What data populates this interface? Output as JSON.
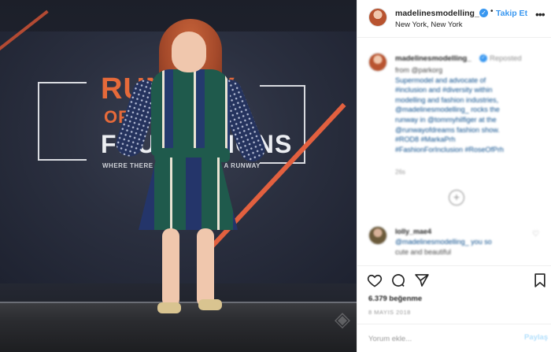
{
  "photo": {
    "sign": {
      "line1": "RUNWAY",
      "line2": "OF",
      "line3": "FOUNDATIONS",
      "line4": "WHERE THERE IS A WILL THERE IS A RUNWAY"
    }
  },
  "header": {
    "username": "madelinesmodelling_",
    "verified_glyph": "✓",
    "follow_label": "Takip Et",
    "location": "New York, New York",
    "more_glyph": "•••"
  },
  "caption": {
    "username": "madelinesmodelling_",
    "reposted": "Reposted",
    "lines": [
      "from @parkorg",
      "Supermodel and advocate of",
      "#inclusion and #diversity within",
      "modelling and fashion industries,",
      "@madelinesmodelling_ rocks the",
      "runway in @tommyhilfiger at the",
      "@runwayofdreams fashion show.",
      "#ROD8 #MarkaPrh",
      "#FashionForInclusion #RoseOfPrh"
    ],
    "time": "26s",
    "load_more": "+"
  },
  "comment": {
    "username": "lolly_mae4",
    "lines": [
      "@madelinesmodelling_ you so",
      "cute and beautiful"
    ],
    "heart": "♡"
  },
  "actions": {
    "likes": "6.379 beğenme",
    "date": "8 MAYIS 2018"
  },
  "comment_box": {
    "placeholder": "Yorum ekle...",
    "post_label": "Paylaş"
  }
}
